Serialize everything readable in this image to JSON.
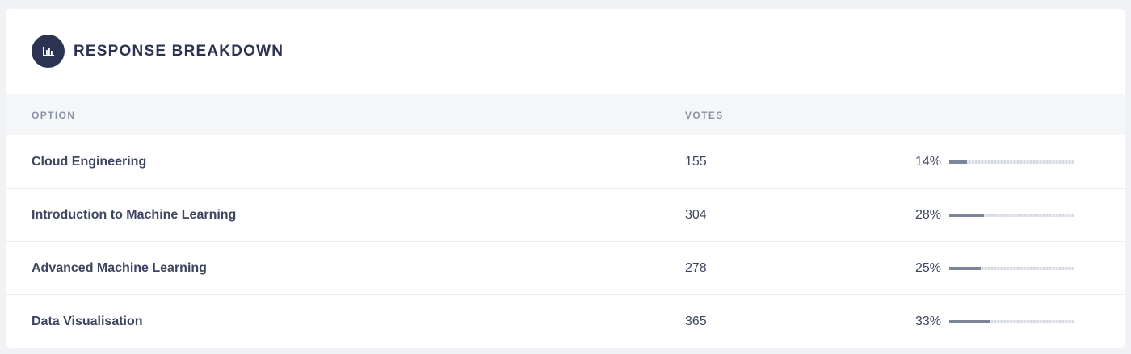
{
  "header": {
    "title": "RESPONSE BREAKDOWN",
    "icon": "bar-chart-icon",
    "icon_bg": "#2b3350"
  },
  "table": {
    "columns": {
      "option": "OPTION",
      "votes": "VOTES"
    },
    "rows": [
      {
        "option": "Cloud Engineering",
        "votes": "155",
        "percent_label": "14%",
        "percent": 14
      },
      {
        "option": "Introduction to Machine Learning",
        "votes": "304",
        "percent_label": "28%",
        "percent": 28
      },
      {
        "option": "Advanced Machine Learning",
        "votes": "278",
        "percent_label": "25%",
        "percent": 25
      },
      {
        "option": "Data Visualisation",
        "votes": "365",
        "percent_label": "33%",
        "percent": 33
      }
    ]
  },
  "colors": {
    "accent": "#2b3350",
    "bar_fill": "#7d8598",
    "text": "#3d4560",
    "muted": "#8a93a6"
  }
}
